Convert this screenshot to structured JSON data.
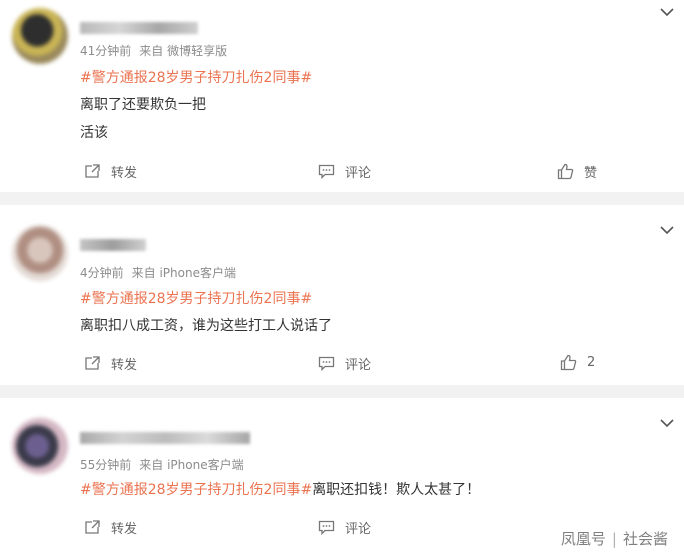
{
  "comments": [
    {
      "meta": "41分钟前",
      "source": "来自 微博轻享版",
      "topic": "#警方通报28岁男子持刀扎伤2同事#",
      "topic_suffix": "",
      "lines": [
        "离职了还要欺负一把",
        "活该"
      ],
      "repost": "转发",
      "comment": "评论",
      "like": "赞"
    },
    {
      "meta": "4分钟前",
      "source": "来自 iPhone客户端",
      "topic": "#警方通报28岁男子持刀扎伤2同事#",
      "topic_suffix": "",
      "lines": [
        "离职扣八成工资，谁为这些打工人说话了"
      ],
      "repost": "转发",
      "comment": "评论",
      "like": "2"
    },
    {
      "meta": "55分钟前",
      "source": "来自 iPhone客户端",
      "topic": "#警方通报28岁男子持刀扎伤2同事#",
      "topic_suffix": "离职还扣钱！欺人太甚了！",
      "lines": [],
      "repost": "转发",
      "comment": "评论",
      "like": ""
    }
  ],
  "watermark": {
    "brand": "凤凰号",
    "channel": "社会酱"
  },
  "colors": {
    "topic": "#eb7350",
    "text": "#333333",
    "muted": "#8c8c8c",
    "separator": "#f2f2f2"
  },
  "icons": [
    "chevron-down-icon",
    "repost-icon",
    "comment-icon",
    "like-icon"
  ]
}
